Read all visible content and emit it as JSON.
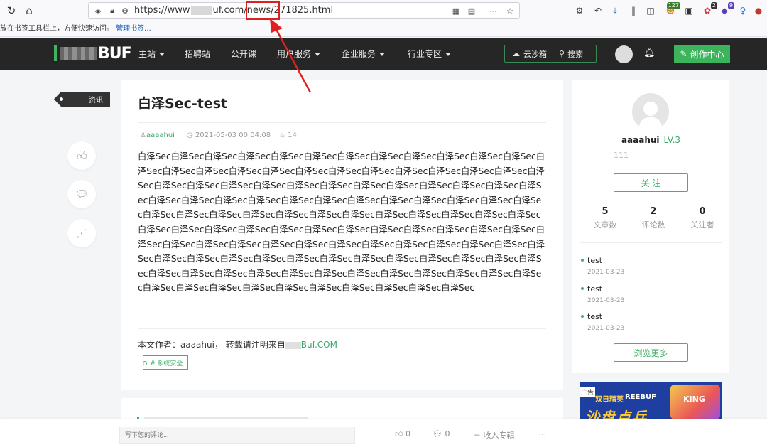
{
  "browser": {
    "url_prefix": "https://www",
    "url_domain_tail": "uf.com/news/",
    "url_id": "271825",
    "url_suffix": ".html",
    "bookmark_notice": "放在书签工具栏上，方便快速访问。",
    "bookmark_link": "管理书签...",
    "extension_badges": [
      "127",
      "2",
      "9"
    ]
  },
  "site": {
    "logo_text": "BUF",
    "nav": [
      "主站",
      "招聘站",
      "公开课",
      "用户服务",
      "企业服务",
      "行业专区"
    ],
    "sandbox_label": "云沙箱",
    "search_label": "搜索",
    "create_label": "创作中心"
  },
  "sidebar_tag": "资讯",
  "article": {
    "title": "白泽Sec-test",
    "author": "aaaahui",
    "date": "2021-05-03 00:04:08",
    "views": "14",
    "body": "白泽Sec白泽Sec白泽Sec白泽Sec白泽Sec白泽Sec白泽Sec白泽Sec白泽Sec白泽Sec白泽Sec白泽Sec白泽Sec白泽Sec白泽Sec白泽Sec白泽Sec白泽Sec白泽Sec白泽Sec白泽Sec白泽Sec白泽Sec白泽Sec白泽Sec白泽Sec白泽Sec白泽Sec白泽Sec白泽Sec白泽Sec白泽Sec白泽Sec白泽Sec白泽Sec白泽Sec白泽Sec白泽Sec白泽Sec白泽Sec白泽Sec白泽Sec白泽Sec白泽Sec白泽Sec白泽Sec白泽Sec白泽Sec白泽Sec白泽Sec白泽Sec白泽Sec白泽Sec白泽Sec白泽Sec白泽Sec白泽Sec白泽Sec白泽Sec白泽Sec白泽Sec白泽Sec白泽Sec白泽Sec白泽Sec白泽Sec白泽Sec白泽Sec白泽Sec白泽Sec白泽Sec白泽Sec白泽Sec白泽Sec白泽Sec白泽Sec白泽Sec白泽Sec白泽Sec白泽Sec白泽Sec白泽Sec白泽Sec白泽Sec白泽Sec白泽Sec白泽Sec白泽Sec白泽Sec白泽Sec白泽Sec白泽Sec白泽Sec白泽Sec白泽Sec白泽Sec白泽Sec白泽Sec白泽Sec白泽Sec白泽Sec白泽Sec白泽Sec白泽Sec白泽Sec白泽Sec白泽Sec白泽Sec白泽Sec白泽Sec白泽Sec白泽Sec白泽Sec白泽Sec白泽Sec白泽Sec白泽Sec白泽Sec白泽Sec白泽Sec",
    "credit_prefix": "本文作者：aaaahui， 转载请注明来自",
    "credit_site": "Buf.COM",
    "topic_tag": "# 系统安全"
  },
  "author_card": {
    "name": "aaaahui",
    "level": "LV.3",
    "bio": "111",
    "follow_label": "关 注",
    "stats": [
      {
        "num": "5",
        "label": "文章数"
      },
      {
        "num": "2",
        "label": "评论数"
      },
      {
        "num": "0",
        "label": "关注者"
      }
    ],
    "recent": [
      {
        "title": "test",
        "date": "2021-03-23"
      },
      {
        "title": "test",
        "date": "2021-03-23"
      },
      {
        "title": "test",
        "date": "2021-03-23"
      }
    ],
    "more_label": "浏览更多"
  },
  "ad": {
    "label": "广告",
    "small": "双日精英",
    "brand": "REEBUF",
    "big": "沙盘点兵",
    "king": "KING"
  },
  "bottom_bar": {
    "comment_placeholder": "写下您的评论...",
    "likes": "0",
    "comments": "0",
    "collect_label": "收入专辑"
  },
  "colors": {
    "accent": "#3cb45b",
    "nav_bg": "#262626",
    "annotation": "#e02020"
  }
}
